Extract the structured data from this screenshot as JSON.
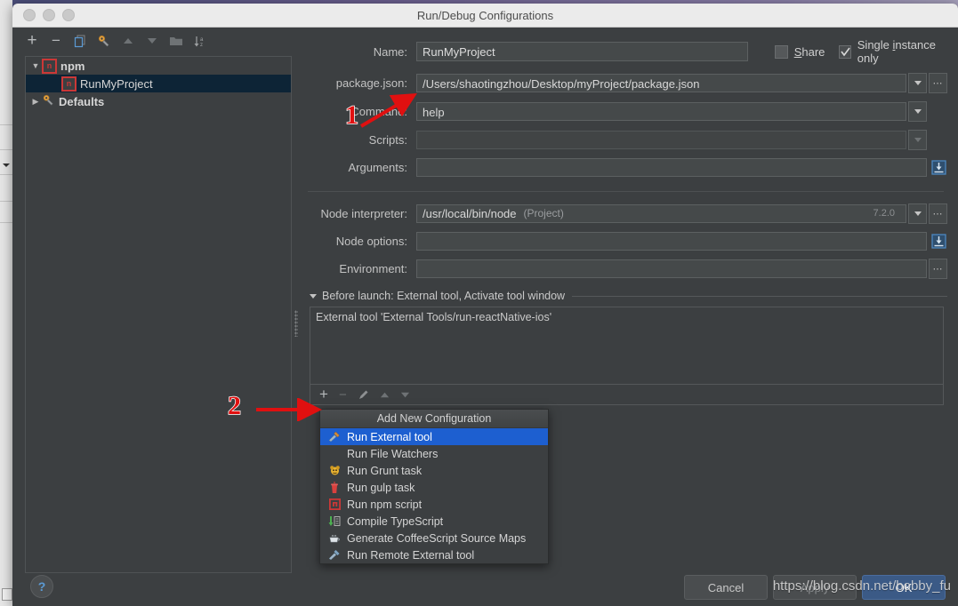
{
  "window": {
    "title": "Run/Debug Configurations",
    "traffic_lights": [
      "close",
      "minimize",
      "zoom"
    ]
  },
  "left_panel": {
    "toolbar_icons": [
      {
        "name": "add-icon",
        "glyph": "+"
      },
      {
        "name": "remove-icon",
        "glyph": "−"
      },
      {
        "name": "copy-icon",
        "glyph": "copy"
      },
      {
        "name": "edit-templates-icon",
        "glyph": "wrench"
      },
      {
        "name": "move-up-icon",
        "glyph": "▲"
      },
      {
        "name": "move-down-icon",
        "glyph": "▼"
      },
      {
        "name": "folder-icon",
        "glyph": "folder"
      },
      {
        "name": "sort-alpha-icon",
        "glyph": "sort"
      }
    ],
    "tree": [
      {
        "label": "npm",
        "icon": "npm-icon",
        "expanded": true,
        "indent": 0,
        "selected": false,
        "bold": true
      },
      {
        "label": "RunMyProject",
        "icon": "npm-icon",
        "expanded": null,
        "indent": 1,
        "selected": true,
        "bold": false
      },
      {
        "label": "Defaults",
        "icon": "wrench-icon",
        "expanded": false,
        "indent": 0,
        "selected": false,
        "bold": true
      }
    ],
    "help_button": "?"
  },
  "form": {
    "name_label": "Name:",
    "name_value": "RunMyProject",
    "share_label_pre": "",
    "share_label": "Share",
    "share_checked": false,
    "single_instance_label": "Single instance only",
    "single_instance_checked": true,
    "fields": [
      {
        "label": "package.json:",
        "value": "/Users/shaotingzhou/Desktop/myProject/package.json",
        "disabled": false,
        "has_dropdown": true,
        "has_dots": true,
        "has_expand": false
      },
      {
        "label": "Command:",
        "value": "help",
        "disabled": false,
        "has_dropdown": true,
        "has_dots": false,
        "has_expand": false
      },
      {
        "label": "Scripts:",
        "value": "",
        "disabled": true,
        "has_dropdown": true,
        "has_dots": false,
        "has_expand": false
      },
      {
        "label": "Arguments:",
        "value": "",
        "disabled": false,
        "has_dropdown": false,
        "has_dots": false,
        "has_expand": true
      }
    ],
    "node_interpreter": {
      "label": "Node interpreter:",
      "value": "/usr/local/bin/node",
      "scope": "(Project)",
      "version": "7.2.0"
    },
    "node_options": {
      "label": "Node options:",
      "value": ""
    },
    "environment": {
      "label": "Environment:",
      "value": ""
    }
  },
  "before_launch": {
    "title": "Before launch: External tool, Activate tool window",
    "entries": [
      "External tool 'External Tools/run-reactNative-ios'"
    ],
    "toolbar_icons": [
      {
        "name": "add-task-icon",
        "glyph": "+"
      },
      {
        "name": "remove-task-icon",
        "glyph": "−"
      },
      {
        "name": "edit-task-icon",
        "glyph": "pencil"
      },
      {
        "name": "move-task-up-icon",
        "glyph": "▲"
      },
      {
        "name": "move-task-down-icon",
        "glyph": "▼"
      }
    ],
    "obscured_text_tail": "dow"
  },
  "menu": {
    "header": "Add New Configuration",
    "items": [
      {
        "label": "Run External tool",
        "icon": "external-tool-icon",
        "selected": true
      },
      {
        "label": "Run File Watchers",
        "icon": "file-watchers-icon",
        "selected": false
      },
      {
        "label": "Run Grunt task",
        "icon": "grunt-icon",
        "selected": false
      },
      {
        "label": "Run gulp task",
        "icon": "gulp-icon",
        "selected": false
      },
      {
        "label": "Run npm script",
        "icon": "npm-icon",
        "selected": false
      },
      {
        "label": "Compile TypeScript",
        "icon": "typescript-icon",
        "selected": false
      },
      {
        "label": "Generate CoffeeScript Source Maps",
        "icon": "coffeescript-icon",
        "selected": false
      },
      {
        "label": "Run Remote External tool",
        "icon": "remote-external-tool-icon",
        "selected": false
      }
    ]
  },
  "buttons": {
    "cancel": "Cancel",
    "apply": "Apply",
    "ok": "OK"
  },
  "annotations": [
    {
      "number": "1",
      "target": "command-field"
    },
    {
      "number": "2",
      "target": "run-external-tool-menu-item"
    }
  ],
  "watermark": "https://blog.csdn.net/bobby_fu",
  "colors": {
    "panel_bg": "#3c3f41",
    "field_bg": "#45494a",
    "selection_blue": "#1d5fd0",
    "tree_selection": "#0d2436",
    "npm_red": "#cb3837",
    "annotation_red": "#e01010",
    "titlebar": "#ebebeb"
  }
}
